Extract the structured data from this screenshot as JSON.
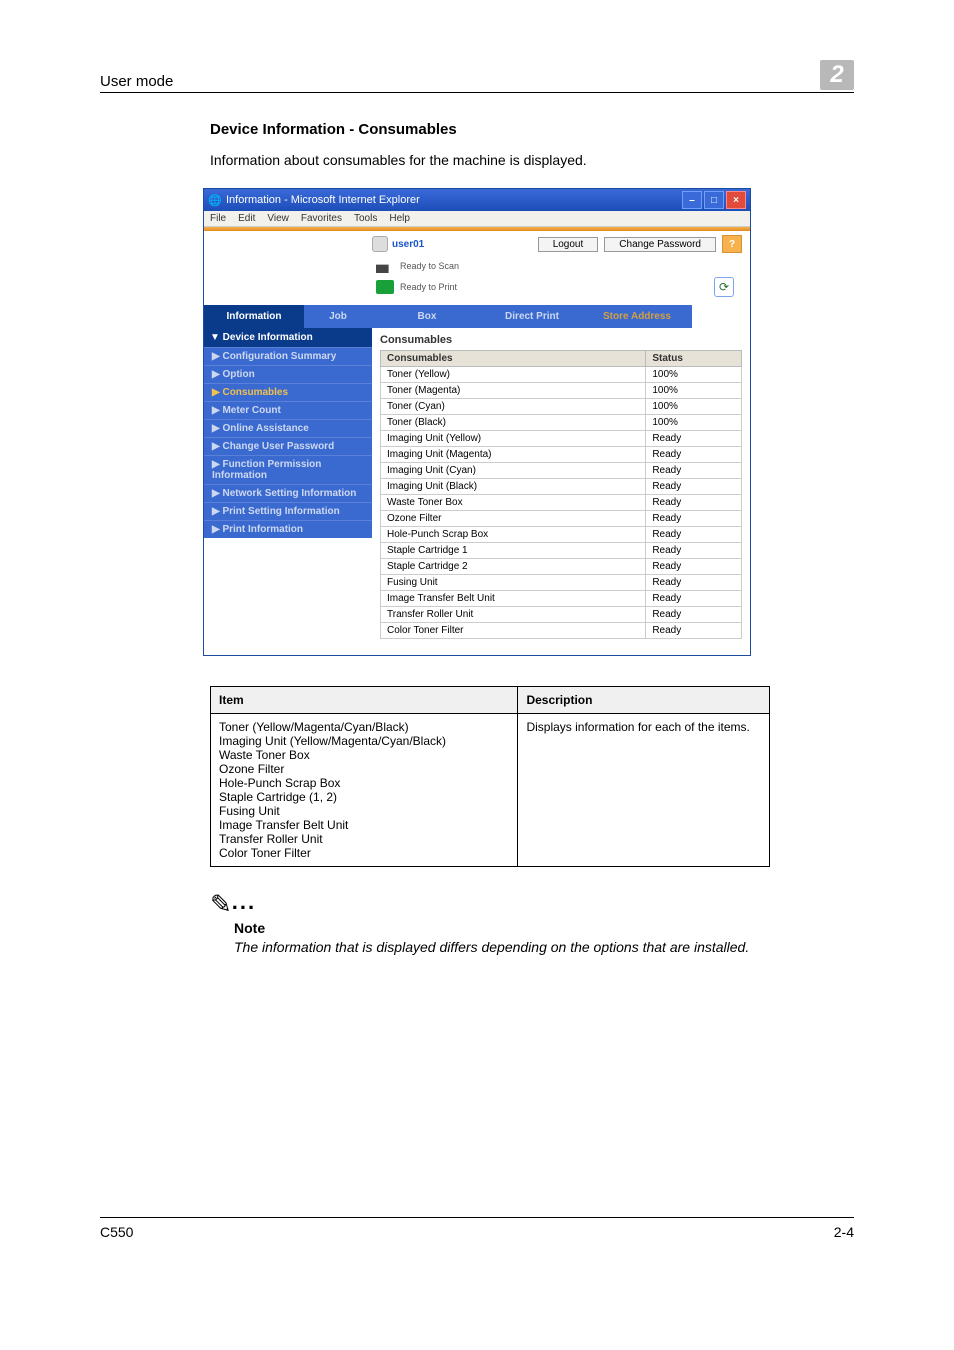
{
  "header": {
    "section": "User mode",
    "chapter": "2"
  },
  "section": {
    "title": "Device Information - Consumables",
    "description": "Information about consumables for the machine is displayed."
  },
  "window": {
    "title": "Information - Microsoft Internet Explorer",
    "menus": [
      "File",
      "Edit",
      "View",
      "Favorites",
      "Tools",
      "Help"
    ],
    "user": "user01",
    "logout": "Logout",
    "change_password": "Change Password",
    "help": "?",
    "status_scan": "Ready to Scan",
    "status_print": "Ready to Print",
    "tabs": [
      "Information",
      "Job",
      "Box",
      "Direct Print",
      "Store Address"
    ],
    "side_header": "▼ Device Information",
    "side_items": [
      "▶ Configuration Summary",
      "▶ Option",
      "▶ Consumables",
      "▶ Meter Count",
      "▶ Online Assistance",
      "▶ Change User Password",
      "▶ Function Permission Information",
      "▶ Network Setting Information",
      "▶ Print Setting Information",
      "▶ Print Information"
    ],
    "main_title": "Consumables",
    "col1": "Consumables",
    "col2": "Status",
    "rows": [
      [
        "Toner (Yellow)",
        "100%"
      ],
      [
        "Toner (Magenta)",
        "100%"
      ],
      [
        "Toner (Cyan)",
        "100%"
      ],
      [
        "Toner (Black)",
        "100%"
      ],
      [
        "Imaging Unit (Yellow)",
        "Ready"
      ],
      [
        "Imaging Unit (Magenta)",
        "Ready"
      ],
      [
        "Imaging Unit (Cyan)",
        "Ready"
      ],
      [
        "Imaging Unit (Black)",
        "Ready"
      ],
      [
        "Waste Toner Box",
        "Ready"
      ],
      [
        "Ozone Filter",
        "Ready"
      ],
      [
        "Hole-Punch Scrap Box",
        "Ready"
      ],
      [
        "Staple Cartridge 1",
        "Ready"
      ],
      [
        "Staple Cartridge 2",
        "Ready"
      ],
      [
        "Fusing Unit",
        "Ready"
      ],
      [
        "Image Transfer Belt Unit",
        "Ready"
      ],
      [
        "Transfer Roller Unit",
        "Ready"
      ],
      [
        "Color Toner Filter",
        "Ready"
      ]
    ]
  },
  "item_table": {
    "header_item": "Item",
    "header_desc": "Description",
    "items": "Toner (Yellow/Magenta/Cyan/Black)\nImaging Unit (Yellow/Magenta/Cyan/Black)\nWaste Toner Box\nOzone Filter\nHole-Punch Scrap Box\nStaple Cartridge (1, 2)\nFusing Unit\nImage Transfer Belt Unit\nTransfer Roller Unit\nColor Toner Filter",
    "desc": "Displays information for each of the items."
  },
  "note": {
    "label": "Note",
    "text": "The information that is displayed differs depending on the options that are installed."
  },
  "footer": {
    "model": "C550",
    "page": "2-4"
  }
}
